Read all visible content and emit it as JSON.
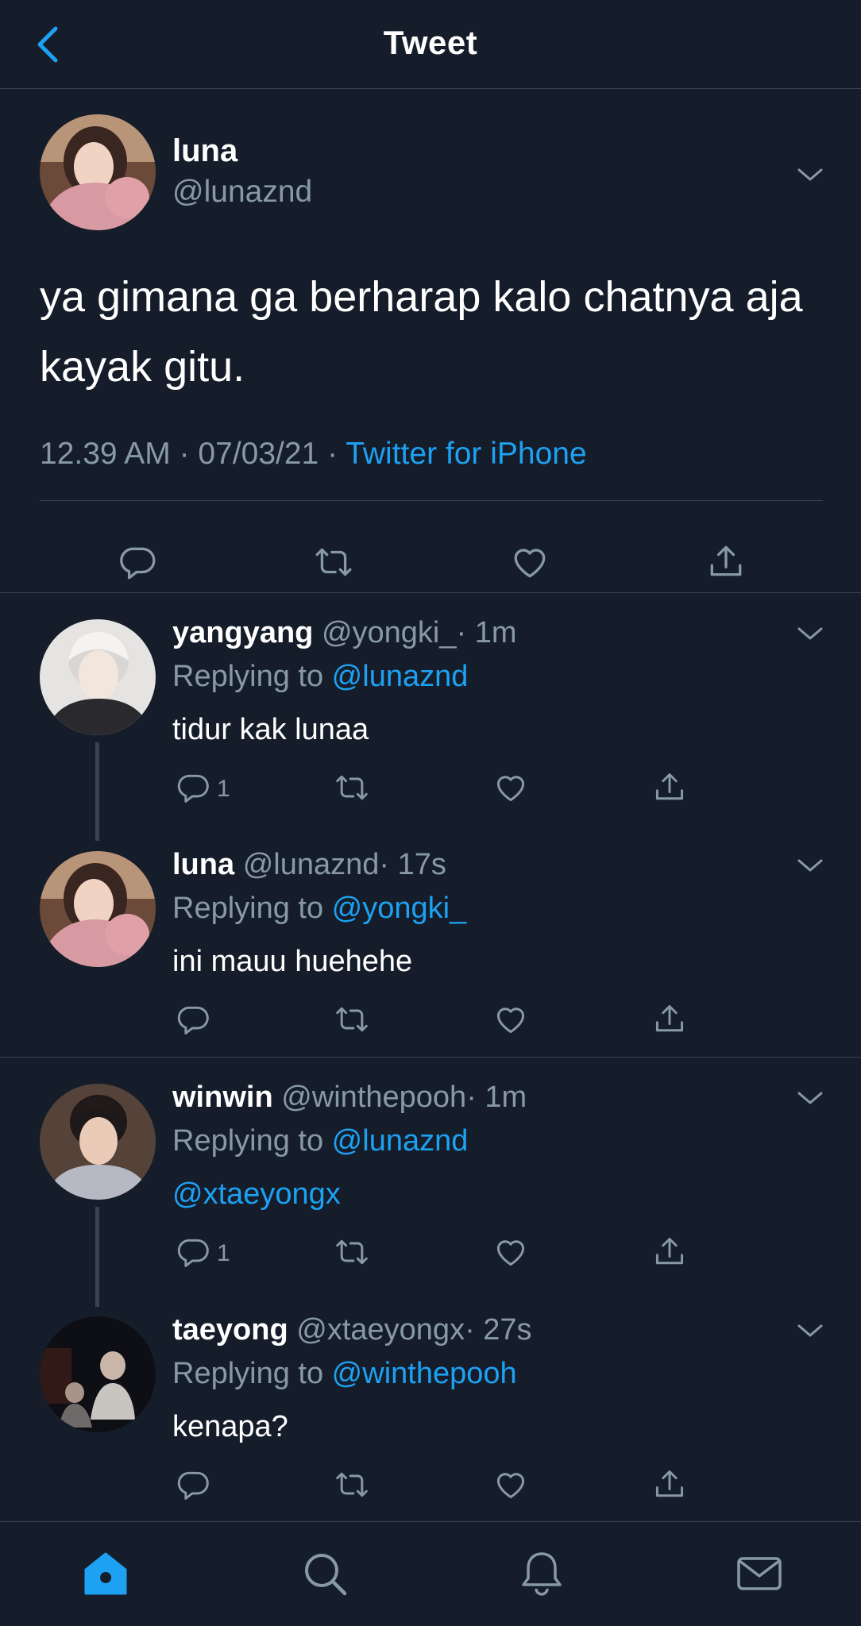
{
  "header": {
    "title": "Tweet",
    "back_icon": "chevron-left-icon"
  },
  "colors": {
    "background": "#151d2a",
    "accent": "#1da1f2",
    "muted": "#8899a6",
    "divider": "#38444d"
  },
  "main_tweet": {
    "name": "luna",
    "handle": "@lunaznd",
    "text": "ya gimana ga berharap kalo chatnya aja kayak gitu.",
    "time": "12.39 AM · 07/03/21 · ",
    "source": "Twitter for iPhone"
  },
  "replies": [
    {
      "name": "yangyang",
      "handle": "@yongki_",
      "dot_time": "· 1m",
      "replying_label": "Replying to ",
      "replying_to": "@lunaznd",
      "text": "tidur kak lunaa",
      "reply_count": "1"
    },
    {
      "name": "luna",
      "handle": "@lunaznd",
      "dot_time": "· 17s",
      "replying_label": "Replying to ",
      "replying_to": "@yongki_",
      "text": "ini mauu huehehe",
      "reply_count": ""
    },
    {
      "name": "winwin",
      "handle": "@winthepooh",
      "dot_time": "· 1m",
      "replying_label": "Replying to ",
      "replying_to": "@lunaznd",
      "text": "@xtaeyongx",
      "reply_count": "1"
    },
    {
      "name": "taeyong",
      "handle": "@xtaeyongx",
      "dot_time": "· 27s",
      "replying_label": "Replying to ",
      "replying_to": "@winthepooh",
      "text": "kenapa?",
      "reply_count": ""
    }
  ],
  "tabbar": {
    "icons": [
      "home-icon",
      "search-icon",
      "bell-icon",
      "mail-icon"
    ]
  }
}
